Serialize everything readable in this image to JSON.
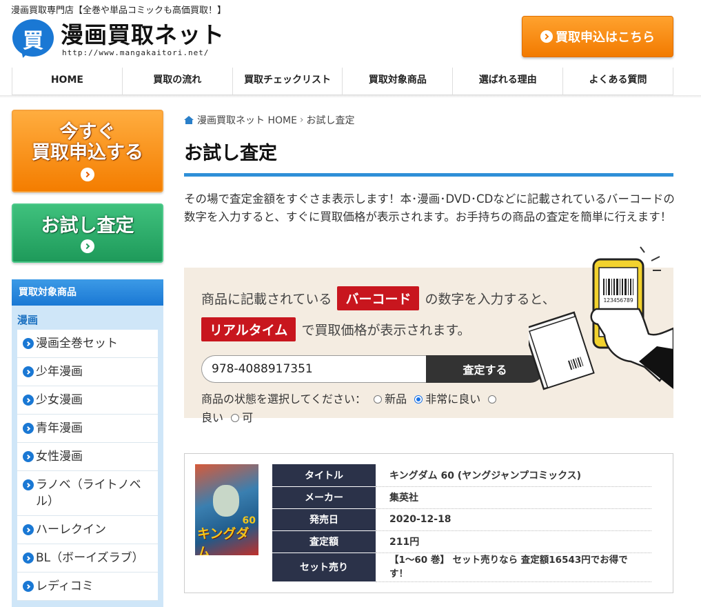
{
  "header": {
    "tagline": "漫画買取専門店【全巻や単品コミックも高価買取！】",
    "logo_kanji": "買",
    "logo_title": "漫画買取ネット",
    "logo_url": "http://www.mangakaitori.net/",
    "apply_button": "買取申込はこちら"
  },
  "nav": [
    "HOME",
    "買取の流れ",
    "買取チェックリスト",
    "買取対象商品",
    "選ばれる理由",
    "よくある質問"
  ],
  "sidebar": {
    "apply_line1": "今すぐ",
    "apply_line2": "買取申込する",
    "trial_label": "お試し査定",
    "category_head": "買取対象商品",
    "category_sub": "漫画",
    "items": [
      "漫画全巻セット",
      "少年漫画",
      "少女漫画",
      "青年漫画",
      "女性漫画",
      "ラノベ（ライトノベル）",
      "ハーレクイン",
      "BL（ボーイズラブ）",
      "レディコミ"
    ]
  },
  "breadcrumb": {
    "home": "漫画買取ネット HOME",
    "current": "お試し査定"
  },
  "page_title": "お試し査定",
  "intro": "その場で査定金額をすぐさま表示します！本･漫画･DVD･CDなどに記載されているバーコードの数字を入力すると、すぐに買取価格が表示されます。お手持ちの商品の査定を簡単に行えます！",
  "checker": {
    "msg1_a": "商品に記載されている",
    "msg1_tag": "バーコード",
    "msg1_b": "の数字を入力すると、",
    "msg2_tag": "リアルタイム",
    "msg2_b": "で買取価格が表示されます。",
    "barcode_sample": "123456789",
    "input_value": "978-4088917351",
    "button": "査定する",
    "condition_label": "商品の状態を選択してください：",
    "options": [
      "新品",
      "非常に良い",
      "良い",
      "可"
    ],
    "selected": "非常に良い"
  },
  "result": {
    "cover_title": "キングダム",
    "cover_volume": "60",
    "rows": [
      {
        "key": "タイトル",
        "value": "キングダム 60 (ヤングジャンプコミックス)"
      },
      {
        "key": "メーカー",
        "value": "集英社"
      },
      {
        "key": "発売日",
        "value": "2020-12-18"
      },
      {
        "key": "査定額",
        "value": "211円"
      },
      {
        "key": "セット売り",
        "value": "【1～60 巻】 セット売りなら 査定額16543円でお得です！"
      }
    ]
  },
  "colors": {
    "orange": "#f27a00",
    "green": "#1e9a5a",
    "blue": "#1a78d4",
    "red": "#c8161e",
    "navy": "#2b3249"
  }
}
